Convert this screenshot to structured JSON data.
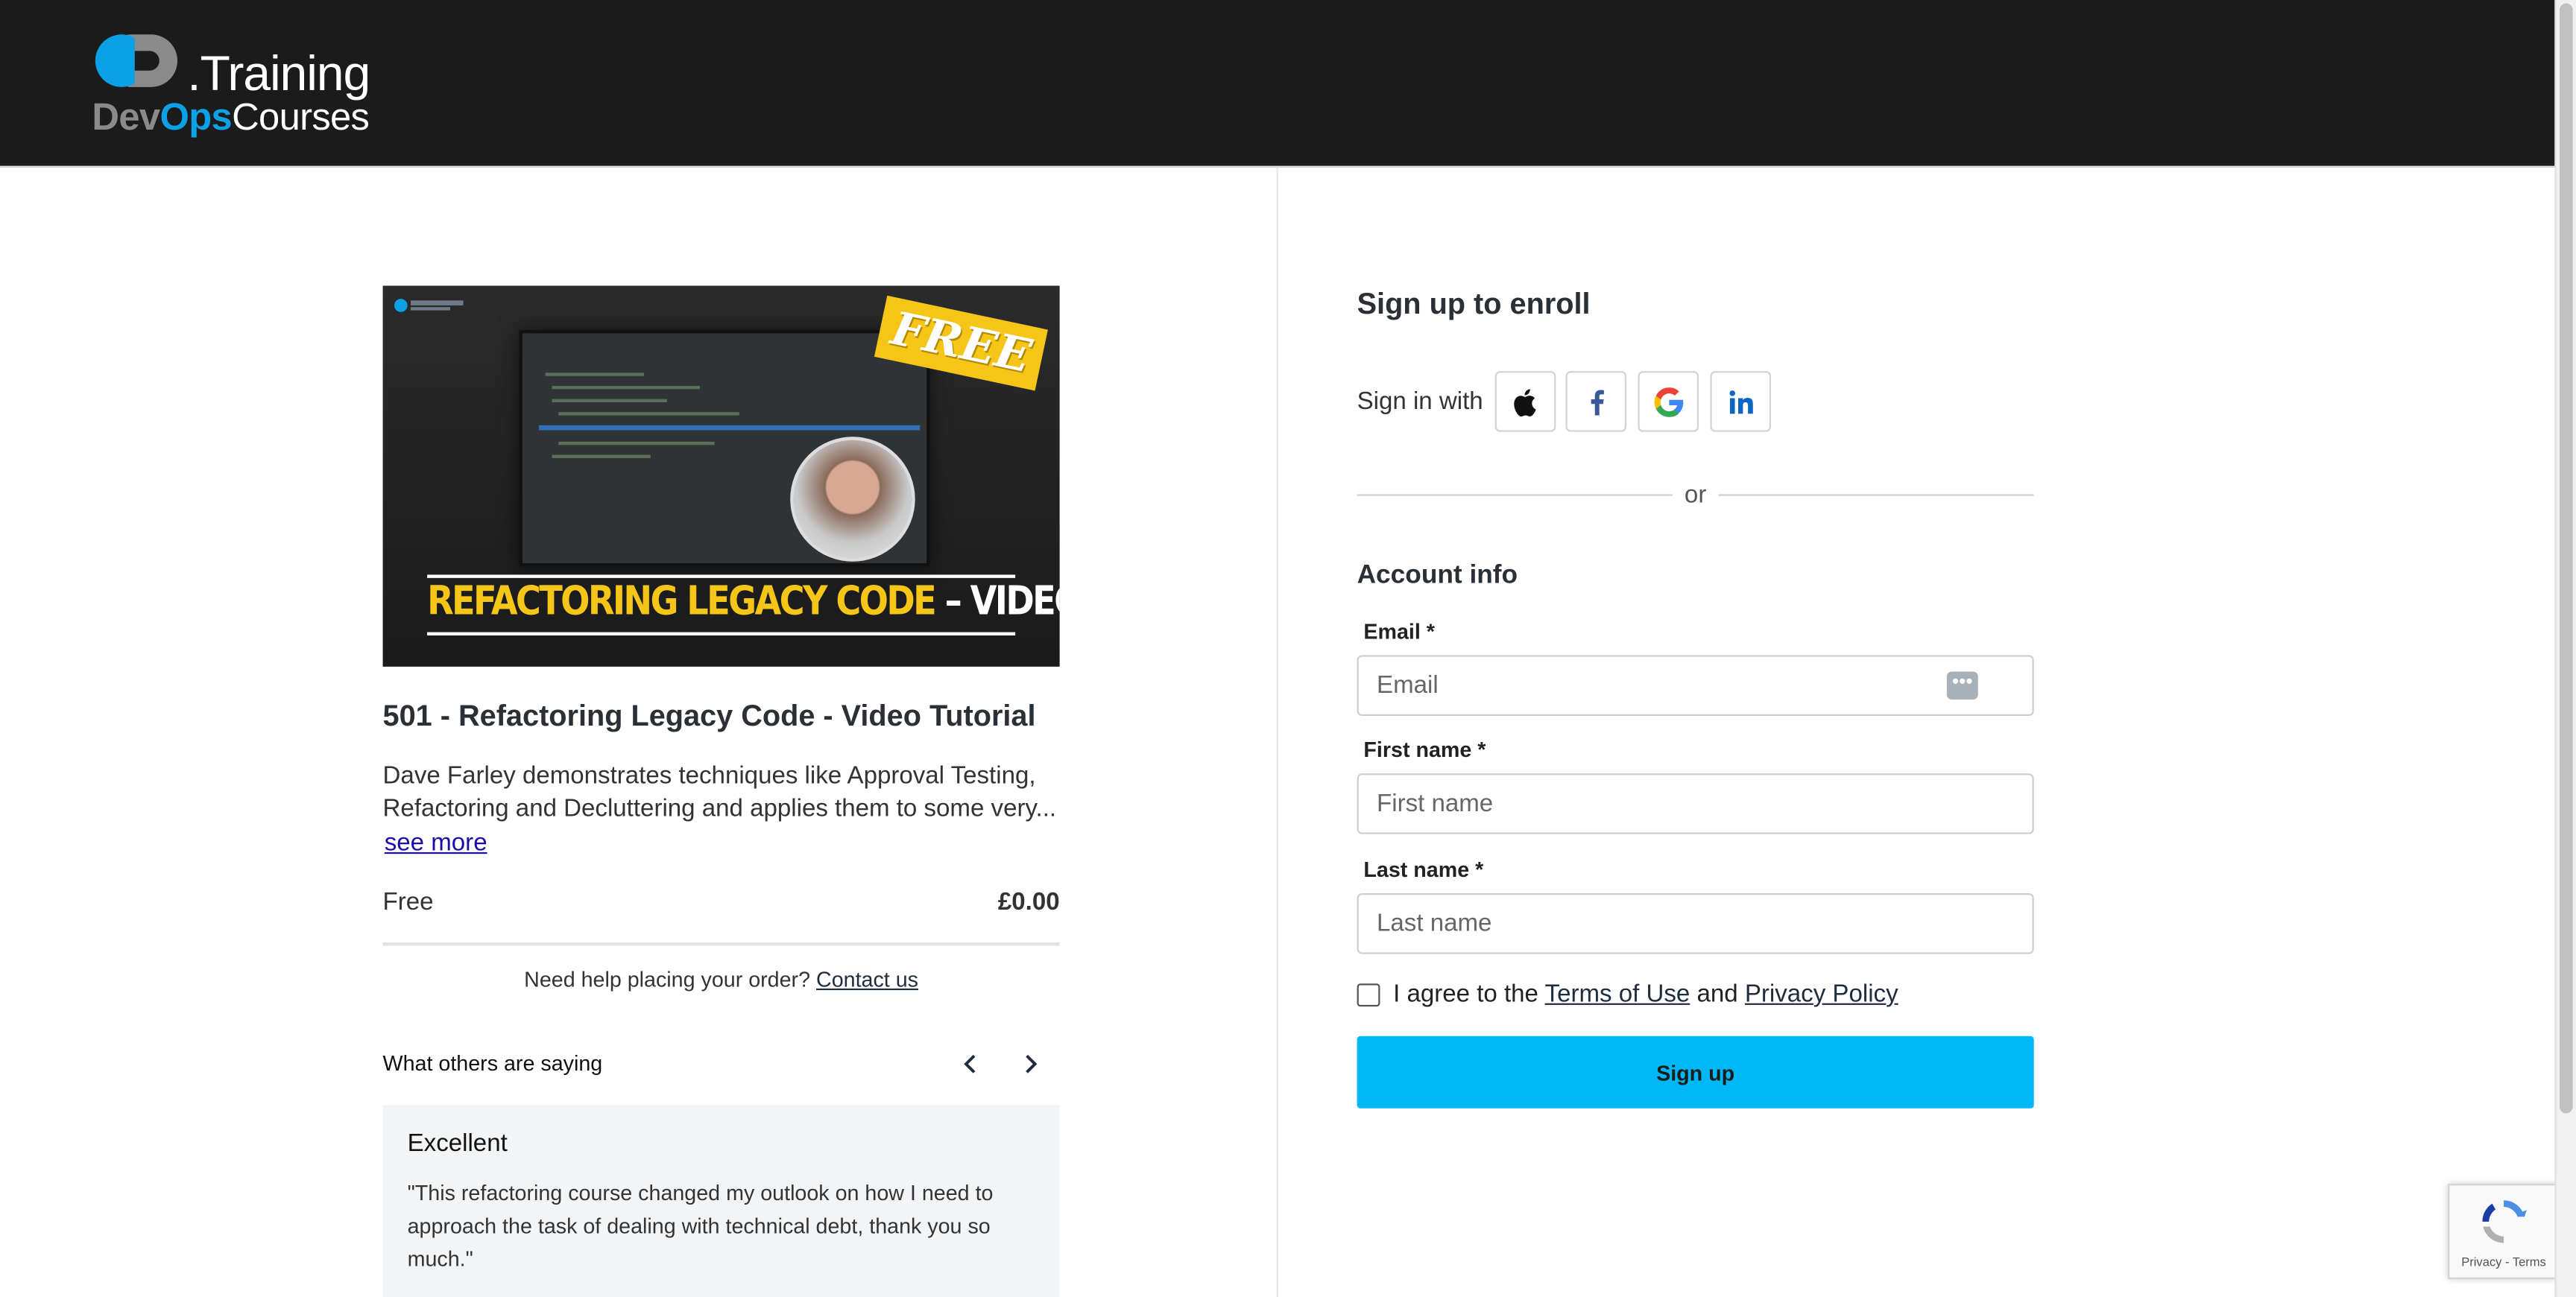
{
  "brand": {
    "logo_training": ".Training",
    "logo_dev": "Dev",
    "logo_ops": "Ops",
    "logo_courses": "Courses",
    "accent": "#0aa1e6",
    "header_bg": "#1b1b1b"
  },
  "course": {
    "thumbnail": {
      "badge": "FREE",
      "title_highlight": "REFACTORING LEGACY CODE",
      "title_rest": " – VIDEO TUTORIAL"
    },
    "title": "501 - Refactoring Legacy Code - Video Tutorial",
    "description": "Dave Farley demonstrates techniques like Approval Testing, Refactoring and Decluttering and applies them to some very...",
    "see_more": "see more",
    "price_label": "Free",
    "price_value": "£0.00",
    "help_text": "Need help placing your order?",
    "help_link": "Contact us"
  },
  "testimonials": {
    "heading": "What others are saying",
    "prev_icon": "chevron-left-icon",
    "next_icon": "chevron-right-icon",
    "current": {
      "title": "Excellent",
      "text": "\"This refactoring course changed my outlook on how I need to approach the task of dealing with technical debt, thank you so much.\""
    }
  },
  "signup": {
    "title": "Sign up to enroll",
    "sign_in_with": "Sign in with",
    "providers": [
      {
        "name": "apple",
        "icon": "apple-icon"
      },
      {
        "name": "facebook",
        "icon": "facebook-icon"
      },
      {
        "name": "google",
        "icon": "google-icon"
      },
      {
        "name": "linkedin",
        "icon": "linkedin-icon"
      }
    ],
    "or": "or",
    "account_info": "Account info",
    "fields": {
      "email": {
        "label": "Email *",
        "placeholder": "Email",
        "value": ""
      },
      "first_name": {
        "label": "First name *",
        "placeholder": "First name",
        "value": ""
      },
      "last_name": {
        "label": "Last name *",
        "placeholder": "Last name",
        "value": ""
      }
    },
    "agree_prefix": "I agree to the",
    "terms_link": "Terms of Use",
    "agree_and": "and",
    "privacy_link": "Privacy Policy",
    "agree_checked": false,
    "button": "Sign up",
    "button_color": "#00b8f5"
  },
  "recaptcha": {
    "links": "Privacy - Terms"
  }
}
